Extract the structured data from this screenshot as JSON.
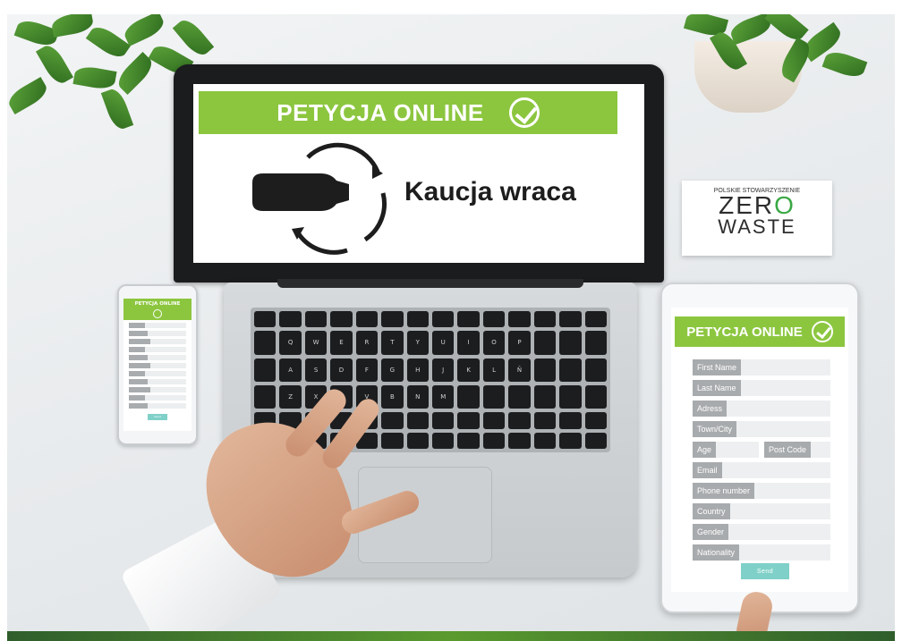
{
  "laptop_screen": {
    "banner_title": "PETYCJA ONLINE",
    "tagline": "Kaucja wraca"
  },
  "logo_card": {
    "org_line": "POLSKIE STOWARZYSZENIE",
    "word_1": "ZER",
    "word_1_o": "O",
    "word_2": "WASTE"
  },
  "tablet_form": {
    "banner_title": "PETYCJA ONLINE",
    "fields": [
      [
        "First Name"
      ],
      [
        "Last Name"
      ],
      [
        "Adress"
      ],
      [
        "Town/City"
      ],
      [
        "Age",
        "Post Code"
      ],
      [
        "Email"
      ],
      [
        "Phone number"
      ],
      [
        "Country"
      ],
      [
        "Gender"
      ],
      [
        "Nationality"
      ]
    ],
    "send_label": "Send"
  },
  "phone_form": {
    "banner_title": "PETYCJA ONLINE",
    "field_count": 11,
    "send_label": "Send"
  },
  "keyboard": {
    "keys": [
      "Q",
      "W",
      "E",
      "R",
      "T",
      "Y",
      "U",
      "I",
      "O",
      "P",
      "A",
      "S",
      "D",
      "F",
      "G",
      "H",
      "J",
      "K",
      "L",
      "Ñ",
      "Z",
      "X",
      "C",
      "V",
      "B",
      "N",
      "M"
    ]
  },
  "colors": {
    "accent_green": "#8cc63f",
    "button_teal": "#7fd0c8",
    "field_label_gray": "#a8abad",
    "logo_green": "#3aa845"
  }
}
